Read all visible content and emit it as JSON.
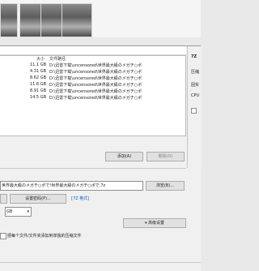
{
  "side_panel": {
    "title": "7Z",
    "labels": [
      "压缩",
      "固实",
      "CPU"
    ]
  },
  "file_list": {
    "columns": {
      "size": "大小",
      "path": "文件路径"
    },
    "rows": [
      {
        "size": "11.1 GB",
        "path": "D:\\迅雷下载\\uncensored\\世界最大級のメガチ○ポ"
      },
      {
        "size": "4.31 GB",
        "path": "D:\\迅雷下载\\uncensored\\世界最大級のメガチ○ポ"
      },
      {
        "size": "8.62 GB",
        "path": "D:\\迅雷下载\\uncensored\\世界最大級のメガチ○ポ"
      },
      {
        "size": "11.8 GB",
        "path": "D:\\迅雷下载\\uncensored\\世界最大級のメガチ○ポ"
      },
      {
        "size": "8.91 GB",
        "path": "D:\\迅雷下载\\uncensored\\世界最大級のメガチ○ポ"
      },
      {
        "size": "14.5 GB",
        "path": "D:\\迅雷下载\\uncensored\\世界最大級のメガチ○ポ"
      }
    ]
  },
  "buttons": {
    "add": "添加(A)",
    "remove": "删除(D)",
    "browse": "浏览(B)...",
    "set_password": "设置密码(P)...",
    "advanced": "▾ 高级设置"
  },
  "output_path": "世界最大級のメガチ○ポで!世界最大級のメガチ○ポで.7z",
  "format_link": "[7Z 格式]",
  "split_value": "GB",
  "checkbox_label": "把每个文件/文件夹添加到单独的压缩文件"
}
